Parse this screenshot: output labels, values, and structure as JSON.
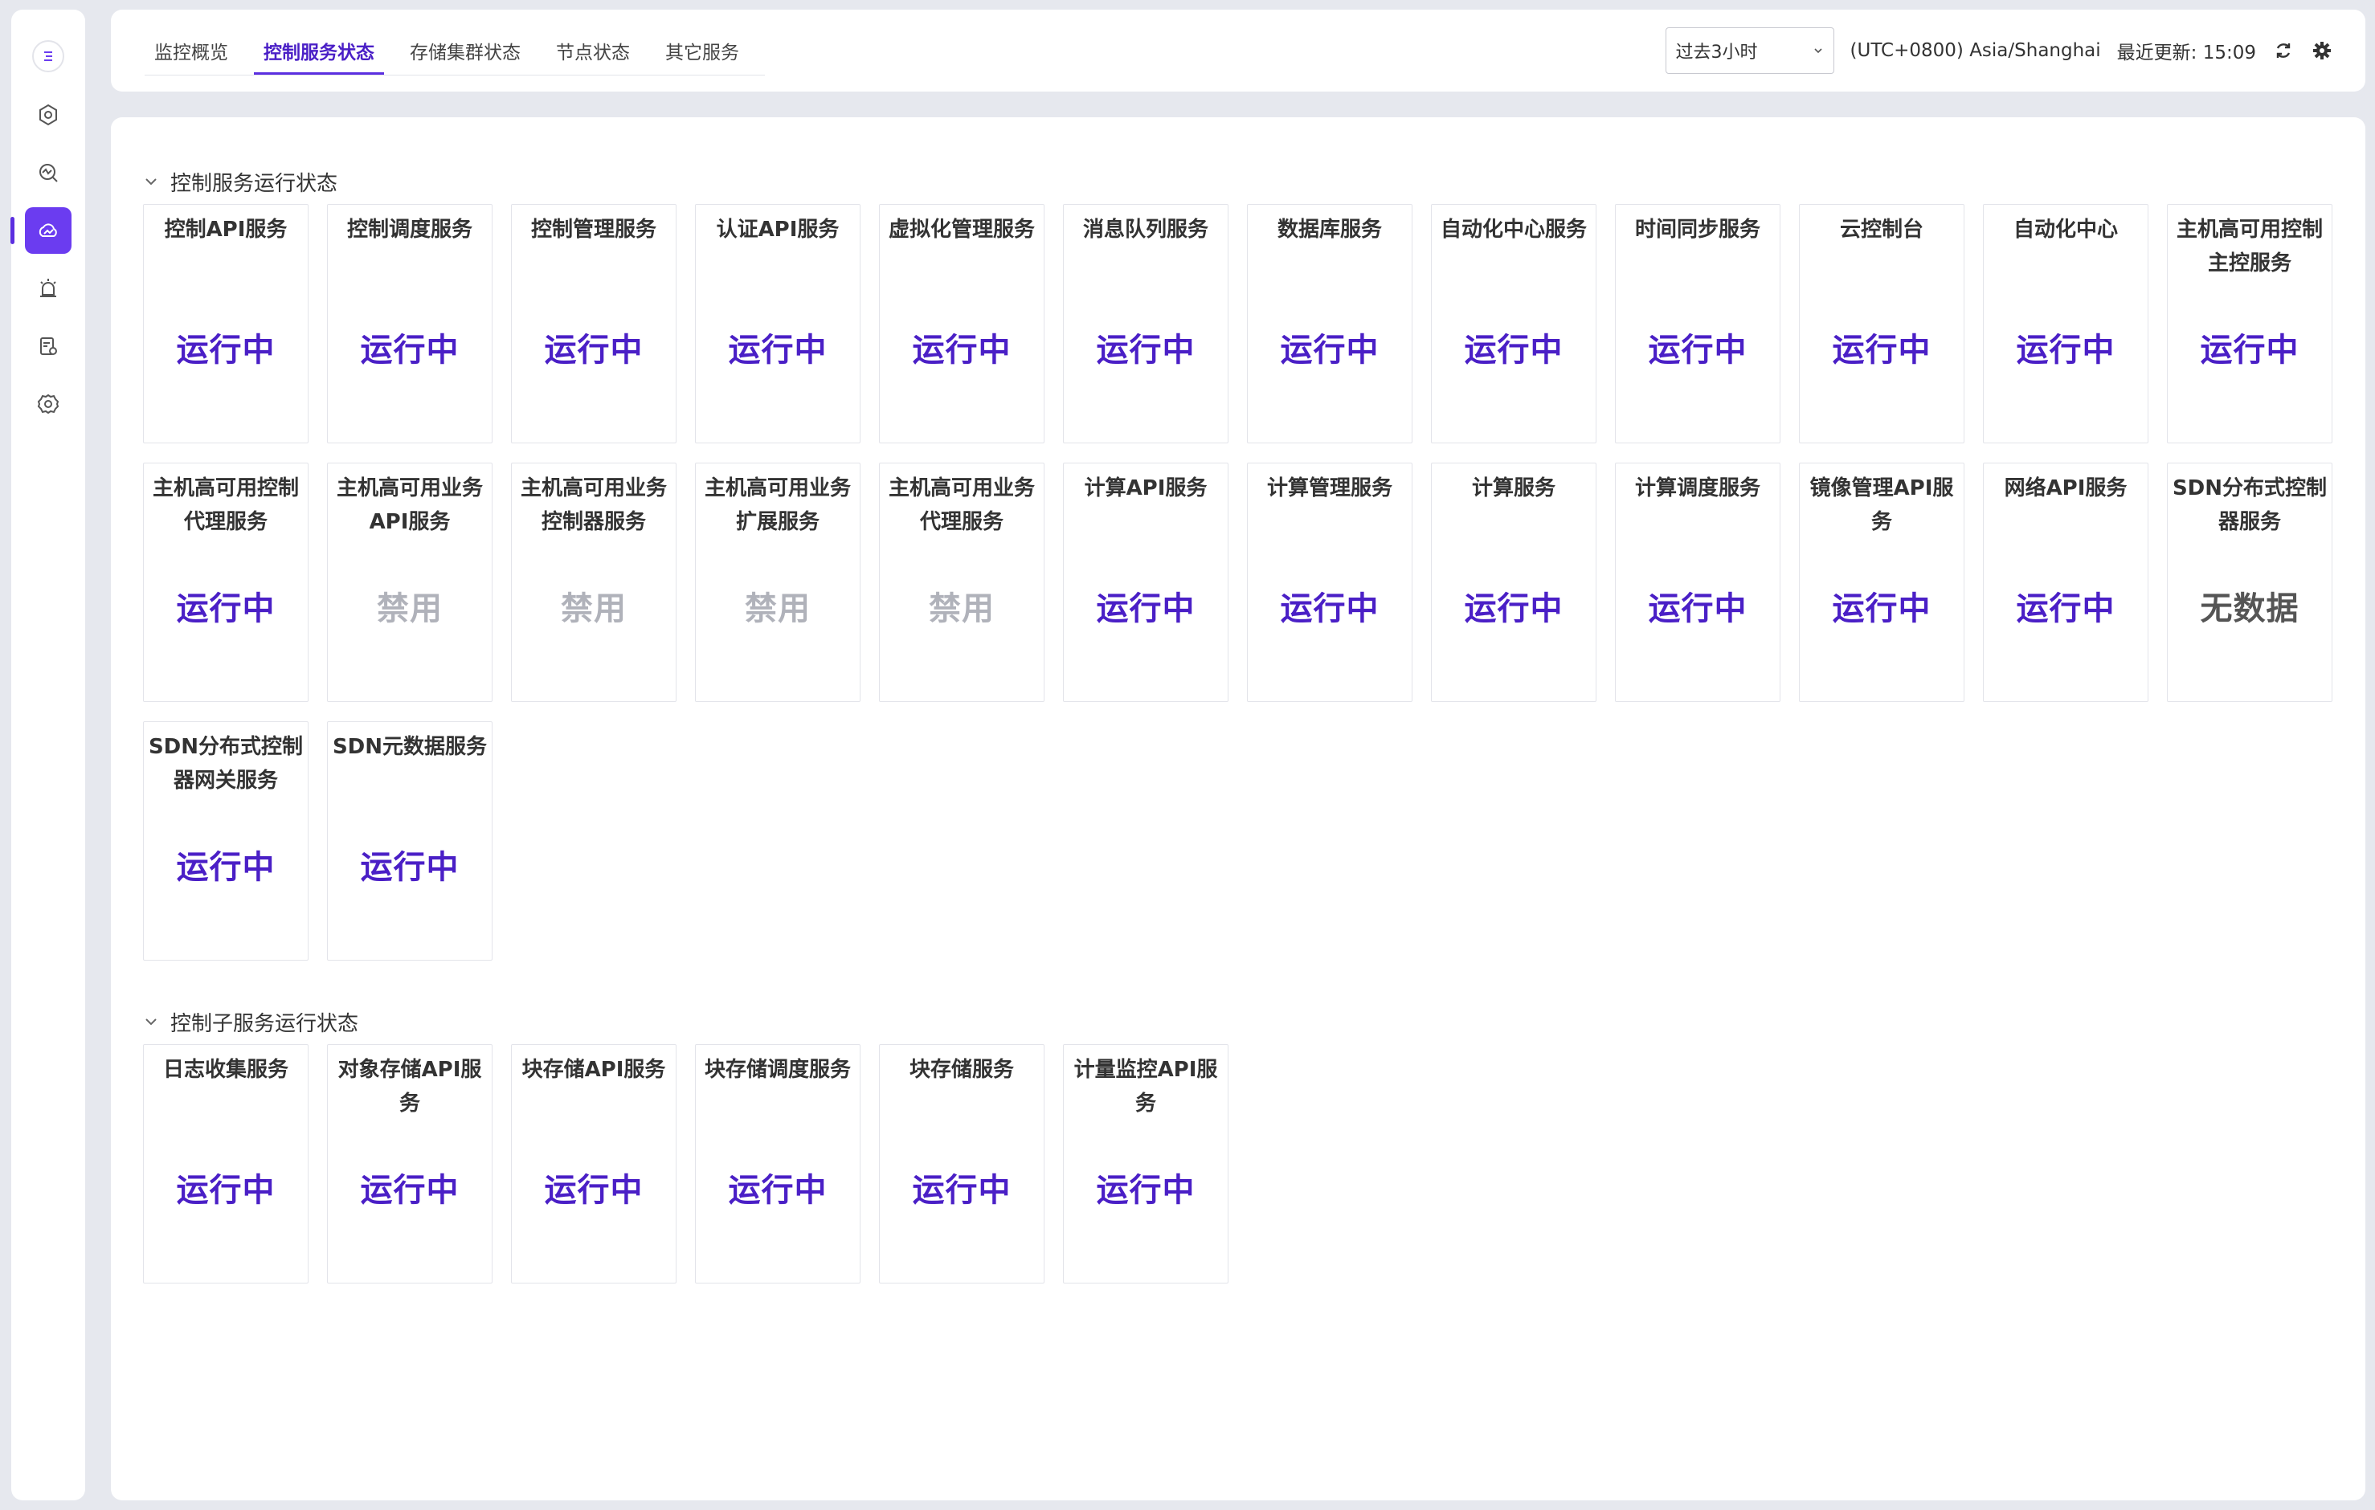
{
  "nav": {
    "items": [
      {
        "icon": "dashboard-icon",
        "active": false
      },
      {
        "icon": "monitor-icon",
        "active": false
      },
      {
        "icon": "cloud-service-icon",
        "active": true
      },
      {
        "icon": "alarm-icon",
        "active": false
      },
      {
        "icon": "report-icon",
        "active": false
      },
      {
        "icon": "settings-icon",
        "active": false
      }
    ]
  },
  "header": {
    "tabs": [
      "监控概览",
      "控制服务状态",
      "存储集群状态",
      "节点状态",
      "其它服务"
    ],
    "active_tab_index": 1,
    "time_range": "过去3小时",
    "timezone": "(UTC+0800) Asia/Shanghai",
    "last_updated": "最近更新: 15:09"
  },
  "sections": [
    {
      "title": "控制服务运行状态",
      "services": [
        {
          "name": "控制API服务",
          "status": "运行中",
          "state": "running"
        },
        {
          "name": "控制调度服务",
          "status": "运行中",
          "state": "running"
        },
        {
          "name": "控制管理服务",
          "status": "运行中",
          "state": "running"
        },
        {
          "name": "认证API服务",
          "status": "运行中",
          "state": "running"
        },
        {
          "name": "虚拟化管理服务",
          "status": "运行中",
          "state": "running"
        },
        {
          "name": "消息队列服务",
          "status": "运行中",
          "state": "running"
        },
        {
          "name": "数据库服务",
          "status": "运行中",
          "state": "running"
        },
        {
          "name": "自动化中心服务",
          "status": "运行中",
          "state": "running"
        },
        {
          "name": "时间同步服务",
          "status": "运行中",
          "state": "running"
        },
        {
          "name": "云控制台",
          "status": "运行中",
          "state": "running"
        },
        {
          "name": "自动化中心",
          "status": "运行中",
          "state": "running"
        },
        {
          "name": "主机高可用控制主控服务",
          "status": "运行中",
          "state": "running"
        },
        {
          "name": "主机高可用控制代理服务",
          "status": "运行中",
          "state": "running"
        },
        {
          "name": "主机高可用业务API服务",
          "status": "禁用",
          "state": "disabled"
        },
        {
          "name": "主机高可用业务控制器服务",
          "status": "禁用",
          "state": "disabled"
        },
        {
          "name": "主机高可用业务扩展服务",
          "status": "禁用",
          "state": "disabled"
        },
        {
          "name": "主机高可用业务代理服务",
          "status": "禁用",
          "state": "disabled"
        },
        {
          "name": "计算API服务",
          "status": "运行中",
          "state": "running"
        },
        {
          "name": "计算管理服务",
          "status": "运行中",
          "state": "running"
        },
        {
          "name": "计算服务",
          "status": "运行中",
          "state": "running"
        },
        {
          "name": "计算调度服务",
          "status": "运行中",
          "state": "running"
        },
        {
          "name": "镜像管理API服务",
          "status": "运行中",
          "state": "running"
        },
        {
          "name": "网络API服务",
          "status": "运行中",
          "state": "running"
        },
        {
          "name": "SDN分布式控制器服务",
          "status": "无数据",
          "state": "nodata"
        },
        {
          "name": "SDN分布式控制器网关服务",
          "status": "运行中",
          "state": "running"
        },
        {
          "name": "SDN元数据服务",
          "status": "运行中",
          "state": "running"
        }
      ]
    },
    {
      "title": "控制子服务运行状态",
      "services": [
        {
          "name": "日志收集服务",
          "status": "运行中",
          "state": "running"
        },
        {
          "name": "对象存储API服务",
          "status": "运行中",
          "state": "running"
        },
        {
          "name": "块存储API服务",
          "status": "运行中",
          "state": "running"
        },
        {
          "name": "块存储调度服务",
          "status": "运行中",
          "state": "running"
        },
        {
          "name": "块存储服务",
          "status": "运行中",
          "state": "running"
        },
        {
          "name": "计量监控API服务",
          "status": "运行中",
          "state": "running"
        }
      ]
    }
  ],
  "colors": {
    "accent": "#5b2fe0",
    "running": "#4a1fc6",
    "disabled": "#b0b2ba",
    "nodata": "#555555"
  }
}
